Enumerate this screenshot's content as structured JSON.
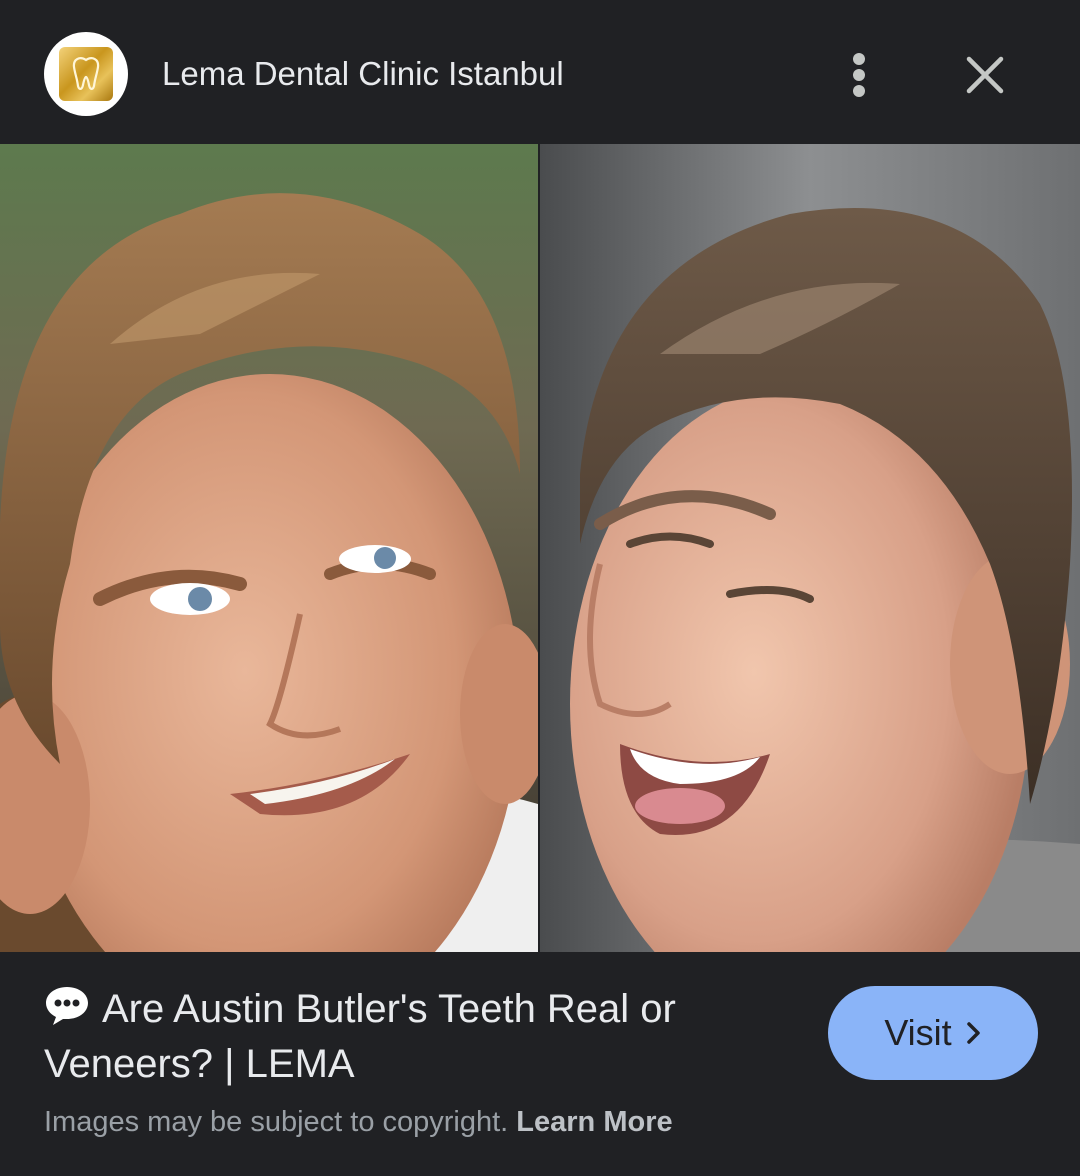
{
  "header": {
    "site_name": "Lema Dental Clinic Istanbul",
    "avatar_icon": "tooth-logo-icon",
    "more_icon": "more-vert-icon",
    "close_icon": "close-icon"
  },
  "image": {
    "left_photo": "person-photo-left",
    "right_photo": "person-photo-right"
  },
  "result": {
    "chat_icon": "speech-bubble-icon",
    "title": "Are Austin Butler's Teeth Real or Veneers? | LEMA",
    "visit_label": "Visit",
    "visit_icon": "chevron-right-icon"
  },
  "footer": {
    "copyright_text": "Images may be subject to copyright.",
    "learn_more_label": "Learn More"
  },
  "colors": {
    "background": "#202124",
    "text": "#e8eaed",
    "muted": "#9aa0a6",
    "accent": "#8ab4f8",
    "logo_gold": "#d4a62a"
  }
}
